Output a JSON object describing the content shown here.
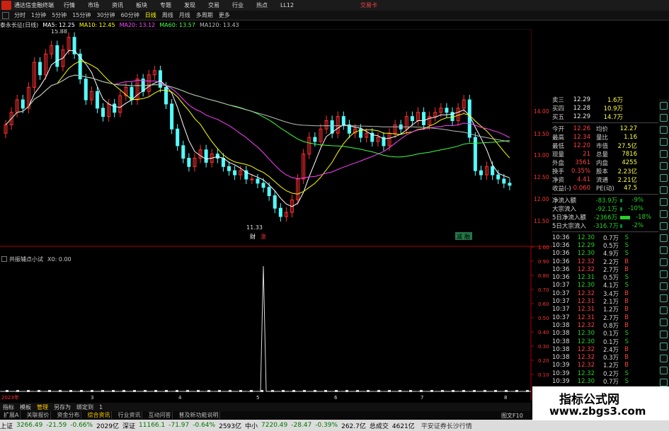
{
  "menubar": {
    "app_title": "通达信金融终端",
    "items": [
      "行情",
      "市场",
      "资讯",
      "板块",
      "专题",
      "发现",
      "交易",
      "行业",
      "热点",
      "LL12"
    ],
    "trade_label": "交易卡"
  },
  "periodbar": {
    "items": [
      "分时",
      "1分钟",
      "5分钟",
      "15分钟",
      "30分钟",
      "60分钟",
      "日线",
      "周线",
      "月线",
      "多周期",
      "更多"
    ],
    "active": "日线"
  },
  "ma_header": {
    "stock": "泰永长征(日线)",
    "ma5": "MA5: 12.25",
    "ma10": "MA10: 12.45",
    "ma20": "MA20: 13.12",
    "ma60": "MA60: 13.57",
    "ma120": "MA120: 13.43"
  },
  "price_chart": {
    "high_label": "15.88",
    "low_label": "11.33",
    "y_ticks": [
      "14.00",
      "13.50",
      "13.00",
      "12.50",
      "12.00",
      "11.50"
    ],
    "markers": [
      "财",
      "涨",
      "减",
      "融"
    ],
    "colors": {
      "up": "#ff3030",
      "down": "#54ffff",
      "ma5": "#ffffff",
      "ma10": "#ffff00",
      "ma20": "#ff40ff",
      "ma60": "#40ff40",
      "ma120": "#bbbbbb"
    }
  },
  "sub_chart": {
    "title": "共振辅点小试",
    "value_label": "X0: 0.00",
    "y_ticks": [
      "1.00",
      "0.90",
      "0.80",
      "0.70",
      "0.60",
      "0.50",
      "0.40",
      "0.30",
      "0.20",
      "0.10"
    ],
    "x_labels": [
      "2023年",
      "3",
      "4",
      "5",
      "6",
      "7",
      "8"
    ]
  },
  "quote": {
    "ask_rows": [
      {
        "label": "卖三",
        "price": "12.29",
        "vol": "1.6万"
      },
      {
        "label": "买四",
        "price": "12.28",
        "vol": "10.9万"
      },
      {
        "label": "买五",
        "price": "12.29",
        "vol": "14.7万"
      }
    ],
    "stats": [
      {
        "l1": "今开",
        "v1": "12.26",
        "l2": "均价",
        "v2": "12.27"
      },
      {
        "l1": "最高",
        "v1": "12.34",
        "l2": "量比",
        "v2": "1.16"
      },
      {
        "l1": "最低",
        "v1": "12.20",
        "l2": "市值",
        "v2": "27.5亿"
      },
      {
        "l1": "现量",
        "v1": "21",
        "l2": "总量",
        "v2": "7816"
      },
      {
        "l1": "外盘",
        "v1": "3561",
        "l2": "内盘",
        "v2": "4255"
      },
      {
        "l1": "换手",
        "v1": "0.35%",
        "l2": "股本",
        "v2": "2.23亿"
      },
      {
        "l1": "净资",
        "v1": "4.41",
        "l2": "流通",
        "v2": "2.21亿"
      },
      {
        "l1": "收益(-)",
        "v1": "0.060",
        "l2": "PE(动)",
        "v2": "47.5"
      }
    ],
    "flows": [
      {
        "label": "净流入额",
        "value": "-83.9万",
        "pct": "-9%"
      },
      {
        "label": "大宗流入",
        "value": "-92.1万",
        "pct": "-10%"
      },
      {
        "label": "5日净流入额",
        "value": "-2366万",
        "pct": "-18%"
      },
      {
        "label": "5日大宗流入",
        "value": "-316.7万",
        "pct": "-2%"
      }
    ],
    "ticks": [
      {
        "t": "10:36",
        "p": "12.30",
        "v": "0.7万",
        "s": "S"
      },
      {
        "t": "10:36",
        "p": "12.29",
        "v": "0.5万",
        "s": "S"
      },
      {
        "t": "10:36",
        "p": "12.30",
        "v": "4.9万",
        "s": "S"
      },
      {
        "t": "10:36",
        "p": "12.32",
        "v": "2.2万",
        "s": "B"
      },
      {
        "t": "10:36",
        "p": "12.32",
        "v": "2.7万",
        "s": "B"
      },
      {
        "t": "10:36",
        "p": "12.31",
        "v": "0.5万",
        "s": "S"
      },
      {
        "t": "10:37",
        "p": "12.30",
        "v": "4.1万",
        "s": "S"
      },
      {
        "t": "10:37",
        "p": "12.32",
        "v": "3.4万",
        "s": "B"
      },
      {
        "t": "10:37",
        "p": "12.31",
        "v": "2.1万",
        "s": "B"
      },
      {
        "t": "10:37",
        "p": "12.31",
        "v": "1.2万",
        "s": "B"
      },
      {
        "t": "10:37",
        "p": "12.31",
        "v": "2.7万",
        "s": "B"
      },
      {
        "t": "10:38",
        "p": "12.32",
        "v": "0.8万",
        "s": "B"
      },
      {
        "t": "10:38",
        "p": "12.30",
        "v": "0.1万",
        "s": "S"
      },
      {
        "t": "10:38",
        "p": "12.30",
        "v": "0.1万",
        "s": "S"
      },
      {
        "t": "10:38",
        "p": "12.32",
        "v": "2.4万",
        "s": "B"
      },
      {
        "t": "10:38",
        "p": "12.32",
        "v": "0.3万",
        "s": "B"
      },
      {
        "t": "10:39",
        "p": "12.32",
        "v": "1.2万",
        "s": "B"
      },
      {
        "t": "10:39",
        "p": "12.32",
        "v": "0.2万",
        "s": "S"
      },
      {
        "t": "10:39",
        "p": "12.30",
        "v": "0.7万",
        "s": "S"
      }
    ]
  },
  "bottombar": {
    "items": [
      "指标",
      "模板",
      "管理",
      "另存为",
      "绑定到",
      "1"
    ],
    "active": "管理"
  },
  "tabbar": {
    "items": [
      "扩展A",
      "关联报价",
      "资金分布",
      "综合资讯",
      "行业资讯",
      "互动问答",
      "普及新功能说明"
    ],
    "info": "图文F10"
  },
  "statusbar": {
    "items": [
      {
        "text": "上证",
        "c": ""
      },
      {
        "text": "3266.49",
        "c": "sgreen"
      },
      {
        "text": "-21.59",
        "c": "sgreen"
      },
      {
        "text": "-0.66%",
        "c": "sgreen"
      },
      {
        "text": "2029亿",
        "c": ""
      },
      {
        "text": "深证",
        "c": ""
      },
      {
        "text": "11166.1",
        "c": "sgreen"
      },
      {
        "text": "-71.97",
        "c": "sgreen"
      },
      {
        "text": "-0.64%",
        "c": "sgreen"
      },
      {
        "text": "2593亿",
        "c": ""
      },
      {
        "text": "中小",
        "c": ""
      },
      {
        "text": "7220.49",
        "c": "sgreen"
      },
      {
        "text": "-28.47",
        "c": "sgreen"
      },
      {
        "text": "-0.39%",
        "c": "sgreen"
      },
      {
        "text": "262.7亿",
        "c": ""
      },
      {
        "text": "总成交",
        "c": ""
      },
      {
        "text": "4621亿",
        "c": ""
      }
    ],
    "broker": "平安证券长沙行情"
  },
  "watermark": {
    "title": "指标公式网",
    "url": "www.zbgs3.com"
  }
}
